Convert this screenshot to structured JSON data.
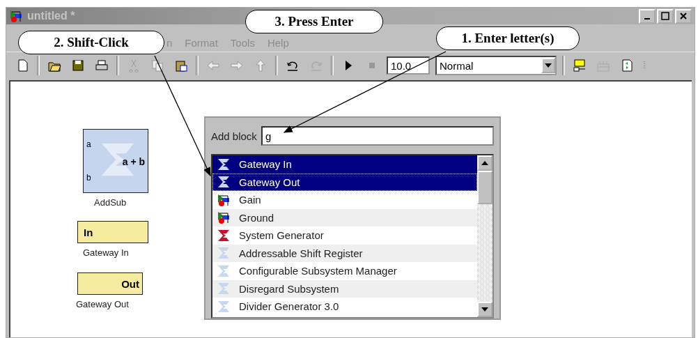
{
  "window": {
    "title": "untitled *"
  },
  "menu": [
    "n",
    "Format",
    "Tools",
    "Help"
  ],
  "toolbar": {
    "stop_time": "10.0",
    "sim_mode": "Normal"
  },
  "callouts": [
    {
      "text": "2. Shift-Click",
      "kind": "list"
    },
    {
      "text": "3. Press Enter",
      "kind": "none"
    },
    {
      "text": "1. Enter letter(s)",
      "kind": "field"
    }
  ],
  "canvas_blocks": [
    {
      "kind": "addsub",
      "label": "AddSub",
      "inputs": [
        "a",
        "b"
      ],
      "output": "a + b"
    },
    {
      "kind": "gateway_in",
      "label": "Gateway In",
      "text": "In"
    },
    {
      "kind": "gateway_out",
      "label": "Gateway Out",
      "text": "Out"
    }
  ],
  "add_block": {
    "label": "Add block",
    "value": "g",
    "items": [
      {
        "label": "Gateway In",
        "kind": "xilinx",
        "selected": true,
        "focused": false
      },
      {
        "label": "Gateway Out",
        "kind": "xilinx",
        "selected": true,
        "focused": true
      },
      {
        "label": "Gain",
        "kind": "simulink",
        "selected": false,
        "focused": false
      },
      {
        "label": "Ground",
        "kind": "simulink",
        "selected": false,
        "focused": false
      },
      {
        "label": "System Generator",
        "kind": "sysgen",
        "selected": false,
        "focused": false
      },
      {
        "label": "Addressable Shift Register",
        "kind": "xilinx",
        "selected": false,
        "focused": false
      },
      {
        "label": "Configurable Subsystem Manager",
        "kind": "xilinx",
        "selected": false,
        "focused": false
      },
      {
        "label": "Disregard Subsystem",
        "kind": "xilinx",
        "selected": false,
        "focused": false
      },
      {
        "label": "Divider Generator 3.0",
        "kind": "xilinx",
        "selected": false,
        "focused": false
      }
    ]
  }
}
